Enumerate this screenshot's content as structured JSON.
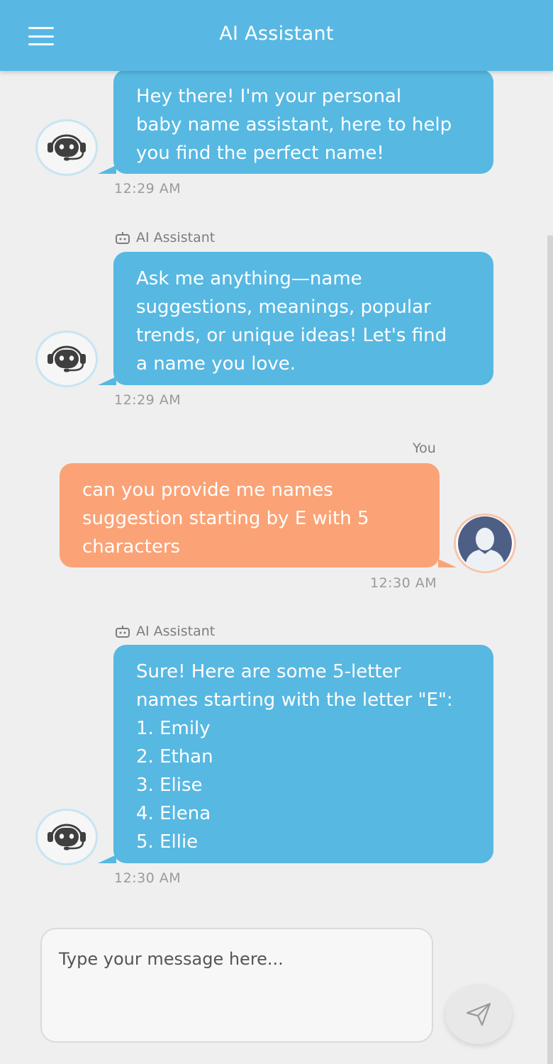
{
  "header": {
    "title": "AI Assistant",
    "menu_icon": "hamburger-menu-icon"
  },
  "messages": [
    {
      "role": "assistant",
      "sender": "",
      "text": " Hey there!  I'm your personal\nbaby name assistant, here to help\nyou find the perfect name!",
      "time": "12:29 AM"
    },
    {
      "role": "assistant",
      "sender": "AI Assistant",
      "text": " Ask me anything—name\nsuggestions, meanings, popular\ntrends, or unique ideas! Let's find\na name you love.",
      "time": "12:29 AM"
    },
    {
      "role": "user",
      "sender": "You",
      "text": " can you provide me names\nsuggestion starting by E with 5\ncharacters",
      "time": "12:30 AM"
    },
    {
      "role": "assistant",
      "sender": "AI Assistant",
      "text": " Sure! Here are some 5-letter\nnames starting with the letter \"E\":\n1. Emily\n2. Ethan\n3. Elise\n4. Elena\n5. Ellie",
      "time": "12:30 AM"
    }
  ],
  "composer": {
    "placeholder": "Type your message here...",
    "send_icon": "send-paper-plane-icon"
  },
  "colors": {
    "header": "#58b8e3",
    "bot_bubble": "#57b8e2",
    "user_bubble": "#fba376",
    "background": "#efefef"
  }
}
